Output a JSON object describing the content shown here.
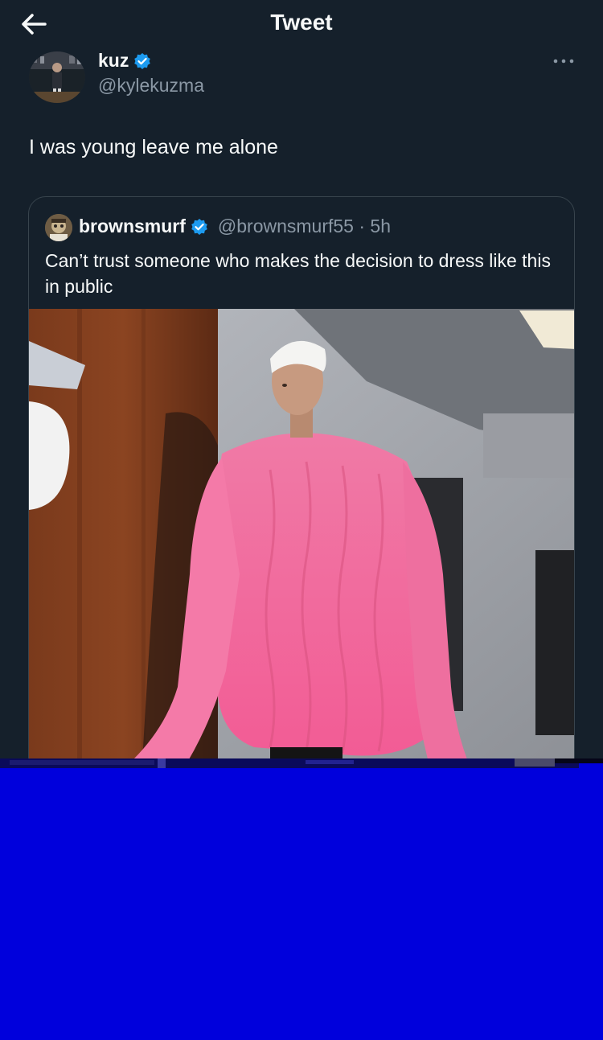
{
  "header": {
    "title": "Tweet",
    "back_icon": "arrow-left-icon"
  },
  "tweet": {
    "author": {
      "name": "kuz",
      "handle": "@kylekuzma",
      "verified": true
    },
    "text": "I was young leave me alone",
    "more_icon": "more-horizontal-icon"
  },
  "quoted_tweet": {
    "author": {
      "name": "brownsmurf",
      "handle": "@brownsmurf55",
      "verified": true
    },
    "separator": "·",
    "time": "5h",
    "text": "Can’t trust someone  who makes the decision to dress like this in public"
  },
  "colors": {
    "background": "#15202b",
    "verified_blue": "#1d9bf0",
    "secondary_text": "#8b98a5",
    "overlay_blue": "#0000dc"
  }
}
